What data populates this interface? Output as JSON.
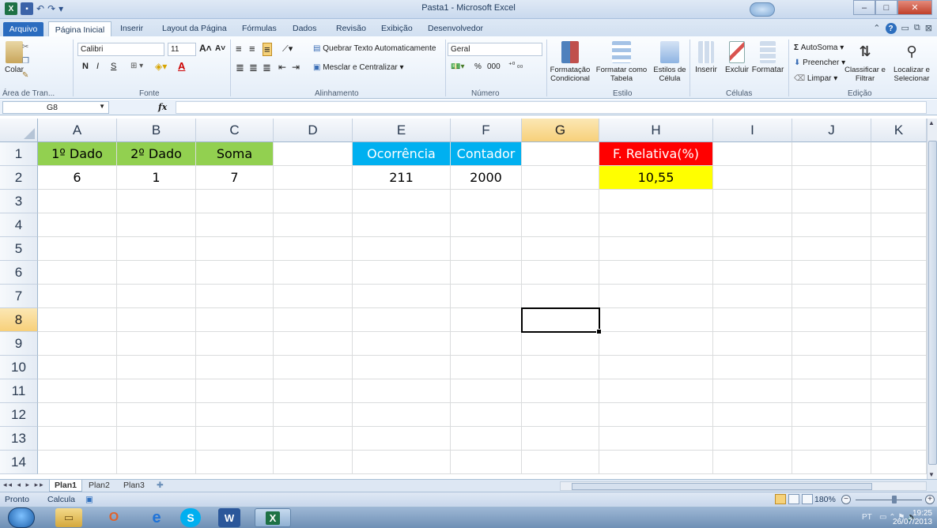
{
  "window": {
    "title": "Pasta1 - Microsoft Excel"
  },
  "ribbon_tabs": {
    "file": "Arquivo",
    "items": [
      "Página Inicial",
      "Inserir",
      "Layout da Página",
      "Fórmulas",
      "Dados",
      "Revisão",
      "Exibição",
      "Desenvolvedor"
    ]
  },
  "ribbon": {
    "clipboard": {
      "paste": "Colar",
      "label": "Área de Tran..."
    },
    "font": {
      "name": "Calibri",
      "size": "11",
      "bold": "N",
      "italic": "I",
      "underline": "S",
      "label": "Fonte"
    },
    "alignment": {
      "wrap": "Quebrar Texto Automaticamente",
      "merge": "Mesclar e Centralizar",
      "label": "Alinhamento"
    },
    "number": {
      "format": "Geral",
      "percent": "%",
      "thousands": "000",
      "label": "Número"
    },
    "styles": {
      "conditional": "Formatação Condicional",
      "as_table": "Formatar como Tabela",
      "cell_styles": "Estilos de Célula",
      "label": "Estilo"
    },
    "cells": {
      "insert": "Inserir",
      "delete": "Excluir",
      "format": "Formatar",
      "label": "Células"
    },
    "editing": {
      "autosum": "AutoSoma",
      "fill": "Preencher",
      "clear": "Limpar",
      "sort": "Classificar e Filtrar",
      "find": "Localizar e Selecionar",
      "label": "Edição"
    }
  },
  "formula_bar": {
    "name_box": "G8",
    "fx": "fx",
    "value": ""
  },
  "grid": {
    "columns": [
      "A",
      "B",
      "C",
      "D",
      "E",
      "F",
      "G",
      "H",
      "I",
      "J",
      "K"
    ],
    "rows": [
      "1",
      "2",
      "3",
      "4",
      "5",
      "6",
      "7",
      "8",
      "9",
      "10",
      "11",
      "12",
      "13",
      "14"
    ],
    "selected_cell": "G8",
    "cells": {
      "A1": "1º Dado",
      "B1": "2º Dado",
      "C1": "Soma",
      "E1": "Ocorrência",
      "F1": "Contador",
      "H1": "F. Relativa(%)",
      "A2": "6",
      "B2": "1",
      "C2": "7",
      "E2": "211",
      "F2": "2000",
      "H2": "10,55"
    },
    "fills": {
      "green": "#92d050",
      "blue": "#00b0f0",
      "red": "#ff0000",
      "yellow": "#ffff00"
    }
  },
  "sheets": {
    "tabs": [
      "Plan1",
      "Plan2",
      "Plan3"
    ],
    "active": "Plan1"
  },
  "status": {
    "ready": "Pronto",
    "calc": "Calcula",
    "zoom": "180%"
  },
  "taskbar": {
    "lang": "PT",
    "time": "19:25",
    "date": "26/07/2013"
  }
}
